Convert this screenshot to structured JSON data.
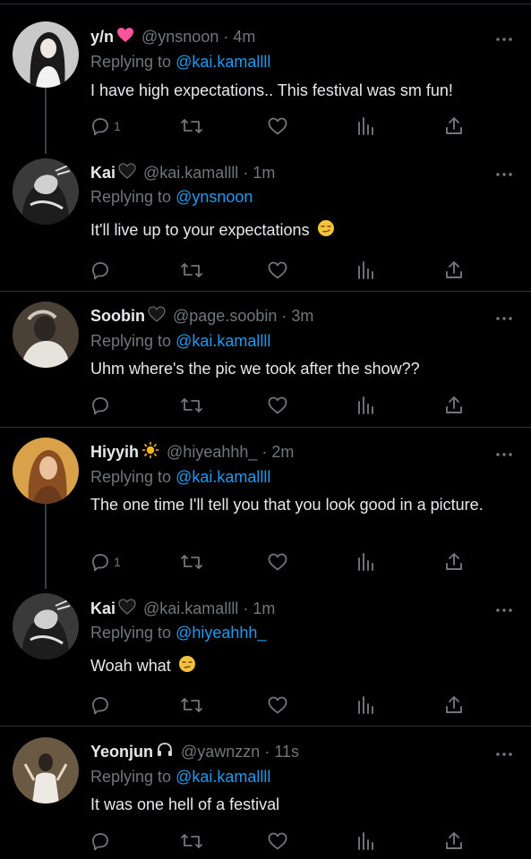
{
  "tweets": [
    {
      "name": "y/n",
      "emoji": "pink-heart",
      "handle": "@ynsnoon",
      "time": "· 4m",
      "replying_prefix": "Replying to",
      "replying_to": "@kai.kamallll",
      "text": "I have high expectations.. This festival was sm fun!",
      "reply_count": "1"
    },
    {
      "name": "Kai",
      "emoji": "black-heart",
      "handle": "@kai.kamallll",
      "time": "· 1m",
      "replying_prefix": "Replying to",
      "replying_to": "@ynsnoon",
      "text": "It'll live up to your expectations",
      "text_emoji": "smirk-face",
      "reply_count": ""
    },
    {
      "name": "Soobin",
      "emoji": "black-heart",
      "handle": "@page.soobin",
      "time": "· 3m",
      "replying_prefix": "Replying to",
      "replying_to": "@kai.kamallll",
      "text": "Uhm where's the pic we took after the show??",
      "reply_count": ""
    },
    {
      "name": "Hiyyih",
      "emoji": "sun",
      "handle": "@hiyeahhh_",
      "time": "· 2m",
      "replying_prefix": "Replying to",
      "replying_to": "@kai.kamallll",
      "text": "The one time I'll tell you that you look good in a picture.",
      "reply_count": "1"
    },
    {
      "name": "Kai",
      "emoji": "black-heart",
      "handle": "@kai.kamallll",
      "time": "· 1m",
      "replying_prefix": "Replying to",
      "replying_to": "@hiyeahhh_",
      "text": "Woah what",
      "text_emoji": "unamused-face",
      "reply_count": ""
    },
    {
      "name": "Yeonjun",
      "emoji": "headphones",
      "handle": "@yawnzzn",
      "time": "· 11s",
      "replying_prefix": "Replying to",
      "replying_to": "@kai.kamallll",
      "text": "It was one hell of a festival",
      "reply_count": ""
    }
  ],
  "icons": {
    "reply": "reply-icon",
    "retweet": "retweet-icon",
    "like": "like-icon",
    "views": "views-icon",
    "share": "share-icon",
    "more": "more-icon"
  },
  "colors": {
    "background": "#000000",
    "text": "#e7e9ea",
    "secondary": "#71767b",
    "accent": "#1d9bf0",
    "divider": "#2f3336",
    "pink_heart": "#f7559b"
  }
}
